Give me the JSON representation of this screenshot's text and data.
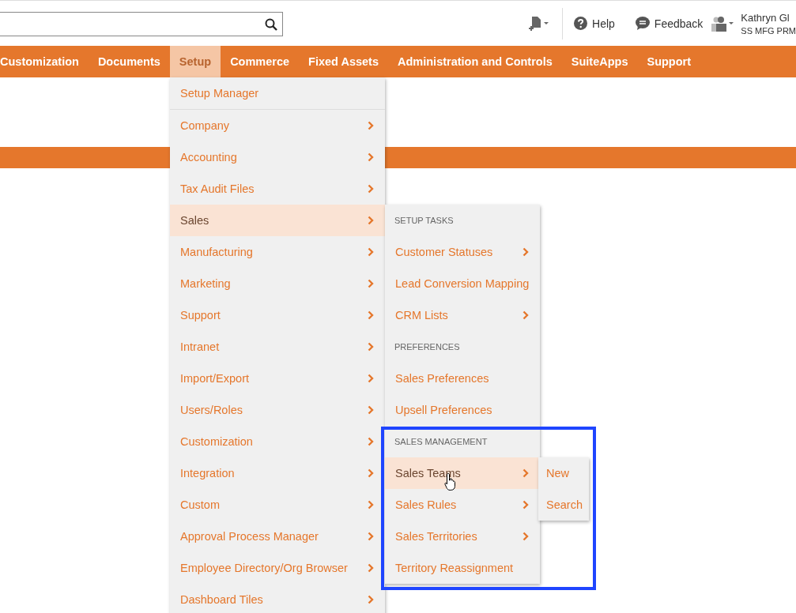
{
  "header": {
    "help": "Help",
    "feedback": "Feedback",
    "user_name": "Kathryn Gl",
    "user_role": "SS MFG PRM"
  },
  "nav": {
    "items": [
      {
        "label": "Customization",
        "selected": false
      },
      {
        "label": "Documents",
        "selected": false
      },
      {
        "label": "Setup",
        "selected": true
      },
      {
        "label": "Commerce",
        "selected": false
      },
      {
        "label": "Fixed Assets",
        "selected": false
      },
      {
        "label": "Administration and Controls",
        "selected": false
      },
      {
        "label": "SuiteApps",
        "selected": false
      },
      {
        "label": "Support",
        "selected": false
      }
    ]
  },
  "menu": {
    "items": [
      {
        "label": "Setup Manager",
        "has_submenu": false,
        "selected": false
      },
      {
        "label": "Company",
        "has_submenu": true,
        "selected": false
      },
      {
        "label": "Accounting",
        "has_submenu": true,
        "selected": false
      },
      {
        "label": "Tax Audit Files",
        "has_submenu": true,
        "selected": false
      },
      {
        "label": "Sales",
        "has_submenu": true,
        "selected": true
      },
      {
        "label": "Manufacturing",
        "has_submenu": true,
        "selected": false
      },
      {
        "label": "Marketing",
        "has_submenu": true,
        "selected": false
      },
      {
        "label": "Support",
        "has_submenu": true,
        "selected": false
      },
      {
        "label": "Intranet",
        "has_submenu": true,
        "selected": false
      },
      {
        "label": "Import/Export",
        "has_submenu": true,
        "selected": false
      },
      {
        "label": "Users/Roles",
        "has_submenu": true,
        "selected": false
      },
      {
        "label": "Customization",
        "has_submenu": true,
        "selected": false
      },
      {
        "label": "Integration",
        "has_submenu": true,
        "selected": false
      },
      {
        "label": "Custom",
        "has_submenu": true,
        "selected": false
      },
      {
        "label": "Approval Process Manager",
        "has_submenu": true,
        "selected": false
      },
      {
        "label": "Employee Directory/Org Browser",
        "has_submenu": true,
        "selected": false
      },
      {
        "label": "Dashboard Tiles",
        "has_submenu": true,
        "selected": false
      }
    ]
  },
  "submenu": {
    "items": [
      {
        "kind": "header",
        "label": "SETUP TASKS"
      },
      {
        "kind": "item",
        "label": "Customer Statuses",
        "has_submenu": true,
        "selected": false
      },
      {
        "kind": "item",
        "label": "Lead Conversion Mapping",
        "has_submenu": false,
        "selected": false
      },
      {
        "kind": "item",
        "label": "CRM Lists",
        "has_submenu": true,
        "selected": false
      },
      {
        "kind": "header",
        "label": "PREFERENCES"
      },
      {
        "kind": "item",
        "label": "Sales Preferences",
        "has_submenu": false,
        "selected": false
      },
      {
        "kind": "item",
        "label": "Upsell Preferences",
        "has_submenu": false,
        "selected": false
      },
      {
        "kind": "header",
        "label": "SALES MANAGEMENT"
      },
      {
        "kind": "item",
        "label": "Sales Teams",
        "has_submenu": true,
        "selected": true
      },
      {
        "kind": "item",
        "label": "Sales Rules",
        "has_submenu": true,
        "selected": false
      },
      {
        "kind": "item",
        "label": "Sales Territories",
        "has_submenu": true,
        "selected": false
      },
      {
        "kind": "item",
        "label": "Territory Reassignment",
        "has_submenu": false,
        "selected": false
      }
    ]
  },
  "flyout": {
    "items": [
      {
        "label": "New"
      },
      {
        "label": "Search"
      }
    ]
  }
}
